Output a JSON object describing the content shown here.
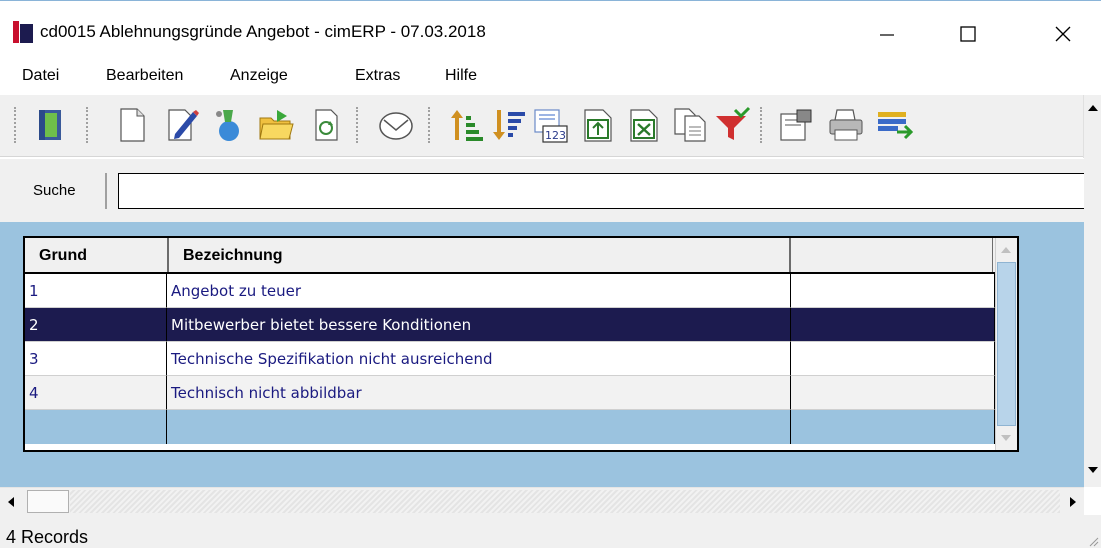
{
  "window": {
    "title": "cd0015 Ablehnungsgründe Angebot - cimERP - 07.03.2018"
  },
  "menu": {
    "items": [
      "Datei",
      "Bearbeiten",
      "Anzeige",
      "Extras",
      "Hilfe"
    ]
  },
  "toolbar": {
    "buttons": [
      {
        "icon": "exit-door-icon"
      },
      {
        "icon": "new-document-icon"
      },
      {
        "icon": "edit-pencil-icon"
      },
      {
        "icon": "save-paint-icon"
      },
      {
        "icon": "open-folder-icon"
      },
      {
        "icon": "refresh-icon"
      },
      {
        "icon": "mail-icon"
      },
      {
        "icon": "sort-ascending-icon"
      },
      {
        "icon": "sort-descending-icon"
      },
      {
        "icon": "calculator-123-icon"
      },
      {
        "icon": "export-icon"
      },
      {
        "icon": "excel-export-icon"
      },
      {
        "icon": "copy-icon"
      },
      {
        "icon": "filter-icon"
      },
      {
        "icon": "properties-icon"
      },
      {
        "icon": "print-icon"
      },
      {
        "icon": "list-arrow-icon"
      }
    ]
  },
  "search": {
    "label": "Suche",
    "value": ""
  },
  "grid": {
    "columns": [
      "Grund",
      "Bezeichnung",
      ""
    ],
    "rows": [
      {
        "grund": "1",
        "bezeichnung": "Angebot zu teuer",
        "extra": ""
      },
      {
        "grund": "2",
        "bezeichnung": "Mitbewerber bietet bessere Konditionen",
        "extra": ""
      },
      {
        "grund": "3",
        "bezeichnung": "Technische Spezifikation nicht ausreichend",
        "extra": ""
      },
      {
        "grund": "4",
        "bezeichnung": "Technisch nicht abbildbar",
        "extra": ""
      }
    ],
    "selected_index": 1
  },
  "status": {
    "text": "4 Records"
  },
  "colors": {
    "selection": "#1c1b4f",
    "panel": "#9bc3df",
    "brand_red": "#c8102e"
  }
}
